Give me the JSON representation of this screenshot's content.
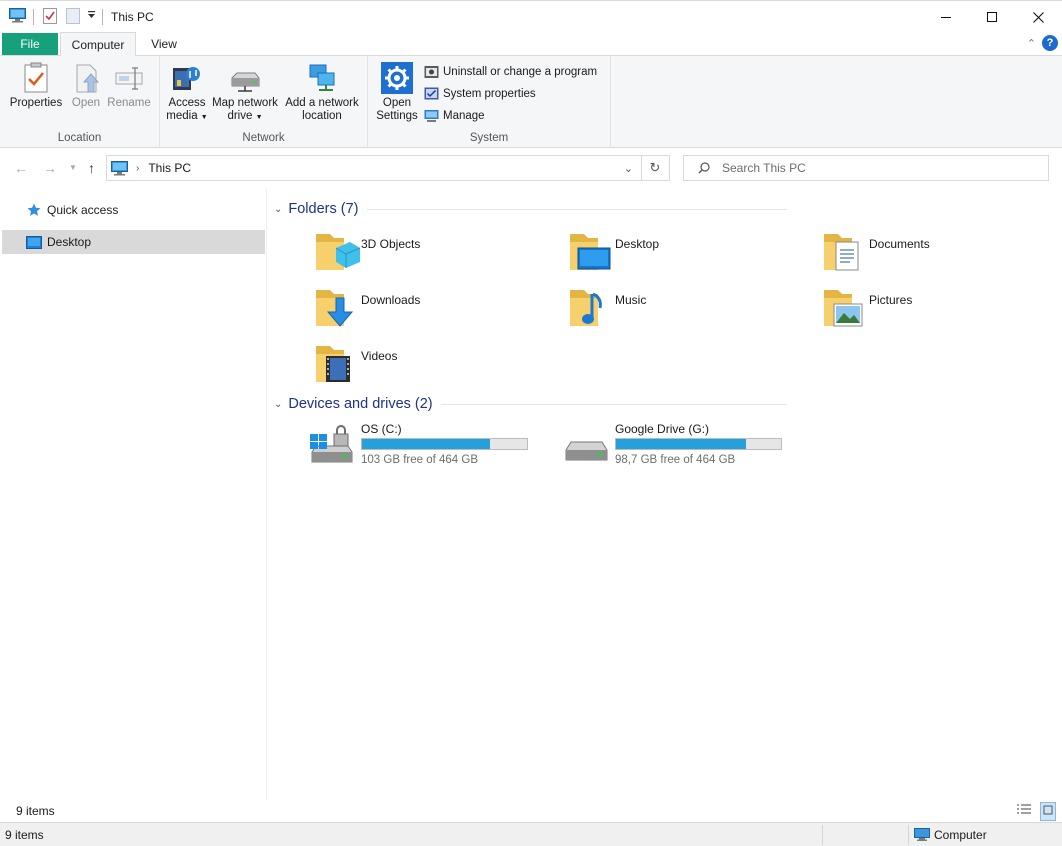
{
  "window": {
    "title": "This PC",
    "minimize_icon": "minimize-icon",
    "maximize_icon": "maximize-icon",
    "close_icon": "close-icon"
  },
  "ribbon_tabs": {
    "file": "File",
    "computer": "Computer",
    "view": "View"
  },
  "ribbon": {
    "location": {
      "label": "Location",
      "properties": "Properties",
      "open": "Open",
      "rename": "Rename"
    },
    "network": {
      "label": "Network",
      "access_media_1": "Access",
      "access_media_2": "media",
      "map_drive_1": "Map network",
      "map_drive_2": "drive",
      "add_location_1": "Add a network",
      "add_location_2": "location"
    },
    "system": {
      "label": "System",
      "open_settings_1": "Open",
      "open_settings_2": "Settings",
      "uninstall": "Uninstall or change a program",
      "system_properties": "System properties",
      "manage": "Manage"
    }
  },
  "address": {
    "path": "This PC",
    "search_placeholder": "Search This PC"
  },
  "nav": {
    "quick_access": "Quick access",
    "desktop": "Desktop"
  },
  "content": {
    "folders_header": "Folders (7)",
    "folders": [
      {
        "name": "3D Objects"
      },
      {
        "name": "Desktop"
      },
      {
        "name": "Documents"
      },
      {
        "name": "Downloads"
      },
      {
        "name": "Music"
      },
      {
        "name": "Pictures"
      },
      {
        "name": "Videos"
      }
    ],
    "drives_header": "Devices and drives (2)",
    "drives": [
      {
        "name": "OS (C:)",
        "free_text": "103 GB free of 464 GB",
        "used_fraction": 0.778
      },
      {
        "name": "Google Drive (G:)",
        "free_text": "98,7 GB free of 464 GB",
        "used_fraction": 0.787
      }
    ]
  },
  "status": {
    "items_count": "9 items",
    "items_count_bottom": "9 items",
    "computer": "Computer"
  },
  "colors": {
    "file_tab": "#16a17c",
    "drive_bar": "#26a0da",
    "group_header": "#1e3287",
    "selection": "#d9d9d9"
  }
}
